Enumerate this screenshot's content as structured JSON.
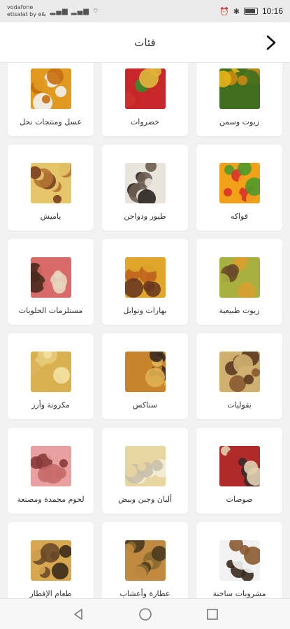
{
  "status_bar": {
    "carrier_line1": "vodafone",
    "carrier_line2": "etisalat by e&",
    "time": "10:16"
  },
  "header": {
    "title": "فئات"
  },
  "categories": [
    {
      "label": "زيوت وسمن",
      "icon": "oil-ghee-photo",
      "colors": [
        "#e6b21a",
        "#3f6f1e",
        "#c98a12"
      ]
    },
    {
      "label": "خضروات",
      "icon": "vegetables-photo",
      "colors": [
        "#3a8a2a",
        "#c7262a",
        "#e7b13a"
      ]
    },
    {
      "label": "عسل ومنتجات نحل",
      "icon": "honey-photo",
      "colors": [
        "#f2f2f2",
        "#e09a20",
        "#c56f10"
      ]
    },
    {
      "label": "فواكه",
      "icon": "fruits-photo",
      "colors": [
        "#d8322a",
        "#f1a21a",
        "#4e9a2a"
      ]
    },
    {
      "label": "طيور ودواجن",
      "icon": "poultry-photo",
      "colors": [
        "#2b2320",
        "#e8e4dc",
        "#6b5e50"
      ]
    },
    {
      "label": "ياميش",
      "icon": "dried-fruits-photo",
      "colors": [
        "#b27432",
        "#e6c66a",
        "#7a3e20"
      ]
    },
    {
      "label": "زيوت طبيعية",
      "icon": "natural-oils-photo",
      "colors": [
        "#6b4a2a",
        "#a8b040",
        "#d8a030"
      ]
    },
    {
      "label": "بهارات وتوابل",
      "icon": "spices-photo",
      "colors": [
        "#c0641e",
        "#e0a62a",
        "#6a3a1e"
      ]
    },
    {
      "label": "مستلزمات الحلويات",
      "icon": "dessert-supplies-photo",
      "colors": [
        "#4a2a1e",
        "#d86a6a",
        "#e8d6c0"
      ]
    },
    {
      "label": "بقوليات",
      "icon": "legumes-photo",
      "colors": [
        "#8a5a30",
        "#d0b070",
        "#5a3a20"
      ]
    },
    {
      "label": "سناكس",
      "icon": "snacks-photo",
      "colors": [
        "#3a2a1e",
        "#c8842a",
        "#e0b050"
      ]
    },
    {
      "label": "مكرونة وأرز",
      "icon": "pasta-rice-photo",
      "colors": [
        "#e8cc7a",
        "#d8b050",
        "#f2e0a0"
      ]
    },
    {
      "label": "صوصات",
      "icon": "sauces-photo",
      "colors": [
        "#3a2a2a",
        "#b02a2a",
        "#e0d0b0"
      ]
    },
    {
      "label": "ألبان وجبن وبيض",
      "icon": "dairy-photo",
      "colors": [
        "#f2eedc",
        "#e8d6a0",
        "#c8c0a8"
      ]
    },
    {
      "label": "لحوم مجمدة ومصنعة",
      "icon": "frozen-meat-photo",
      "colors": [
        "#c86a6a",
        "#e8a0a0",
        "#8a3a3a"
      ]
    },
    {
      "label": "مشروبات ساخنة",
      "icon": "hot-drinks-photo",
      "colors": [
        "#3a2a1e",
        "#f2f2f2",
        "#8a5a30"
      ]
    },
    {
      "label": "عطارة وأعشاب",
      "icon": "herbs-photo",
      "colors": [
        "#8a6a30",
        "#c08a40",
        "#4a3a20"
      ]
    },
    {
      "label": "طعام الإفطار",
      "icon": "breakfast-photo",
      "colors": [
        "#6a4a2a",
        "#d8a850",
        "#3a2a1a"
      ]
    }
  ]
}
